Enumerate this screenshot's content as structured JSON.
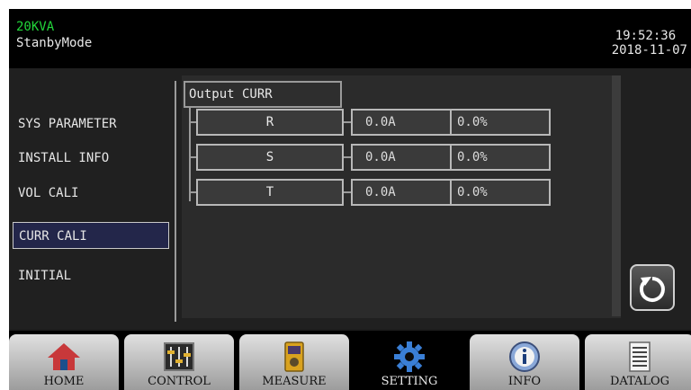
{
  "header": {
    "model": "20KVA",
    "mode": "StanbyMode",
    "time": "19:52:36",
    "date": "2018-11-07"
  },
  "menu": {
    "items": [
      {
        "label": "SYS PARAMETER"
      },
      {
        "label": "INSTALL INFO"
      },
      {
        "label": "VOL CALI"
      },
      {
        "label": "CURR CALI",
        "active": true
      },
      {
        "label": "INITIAL"
      }
    ]
  },
  "panel": {
    "title": "Output CURR",
    "rows": [
      {
        "phase": "R",
        "current": "0.0A",
        "percent": "0.0%"
      },
      {
        "phase": "S",
        "current": "0.0A",
        "percent": "0.0%"
      },
      {
        "phase": "T",
        "current": "0.0A",
        "percent": "0.0%"
      }
    ]
  },
  "nav": {
    "items": [
      {
        "label": "HOME",
        "icon": "home-icon"
      },
      {
        "label": "CONTROL",
        "icon": "sliders-icon"
      },
      {
        "label": "MEASURE",
        "icon": "meter-icon"
      },
      {
        "label": "SETTING",
        "icon": "gear-icon",
        "active": true
      },
      {
        "label": "INFO",
        "icon": "info-icon"
      },
      {
        "label": "DATALOG",
        "icon": "log-icon"
      }
    ]
  },
  "colors": {
    "model_text": "#22d63a",
    "active_menu_bg": "#23264a",
    "gear_blue": "#3a7fd6"
  }
}
